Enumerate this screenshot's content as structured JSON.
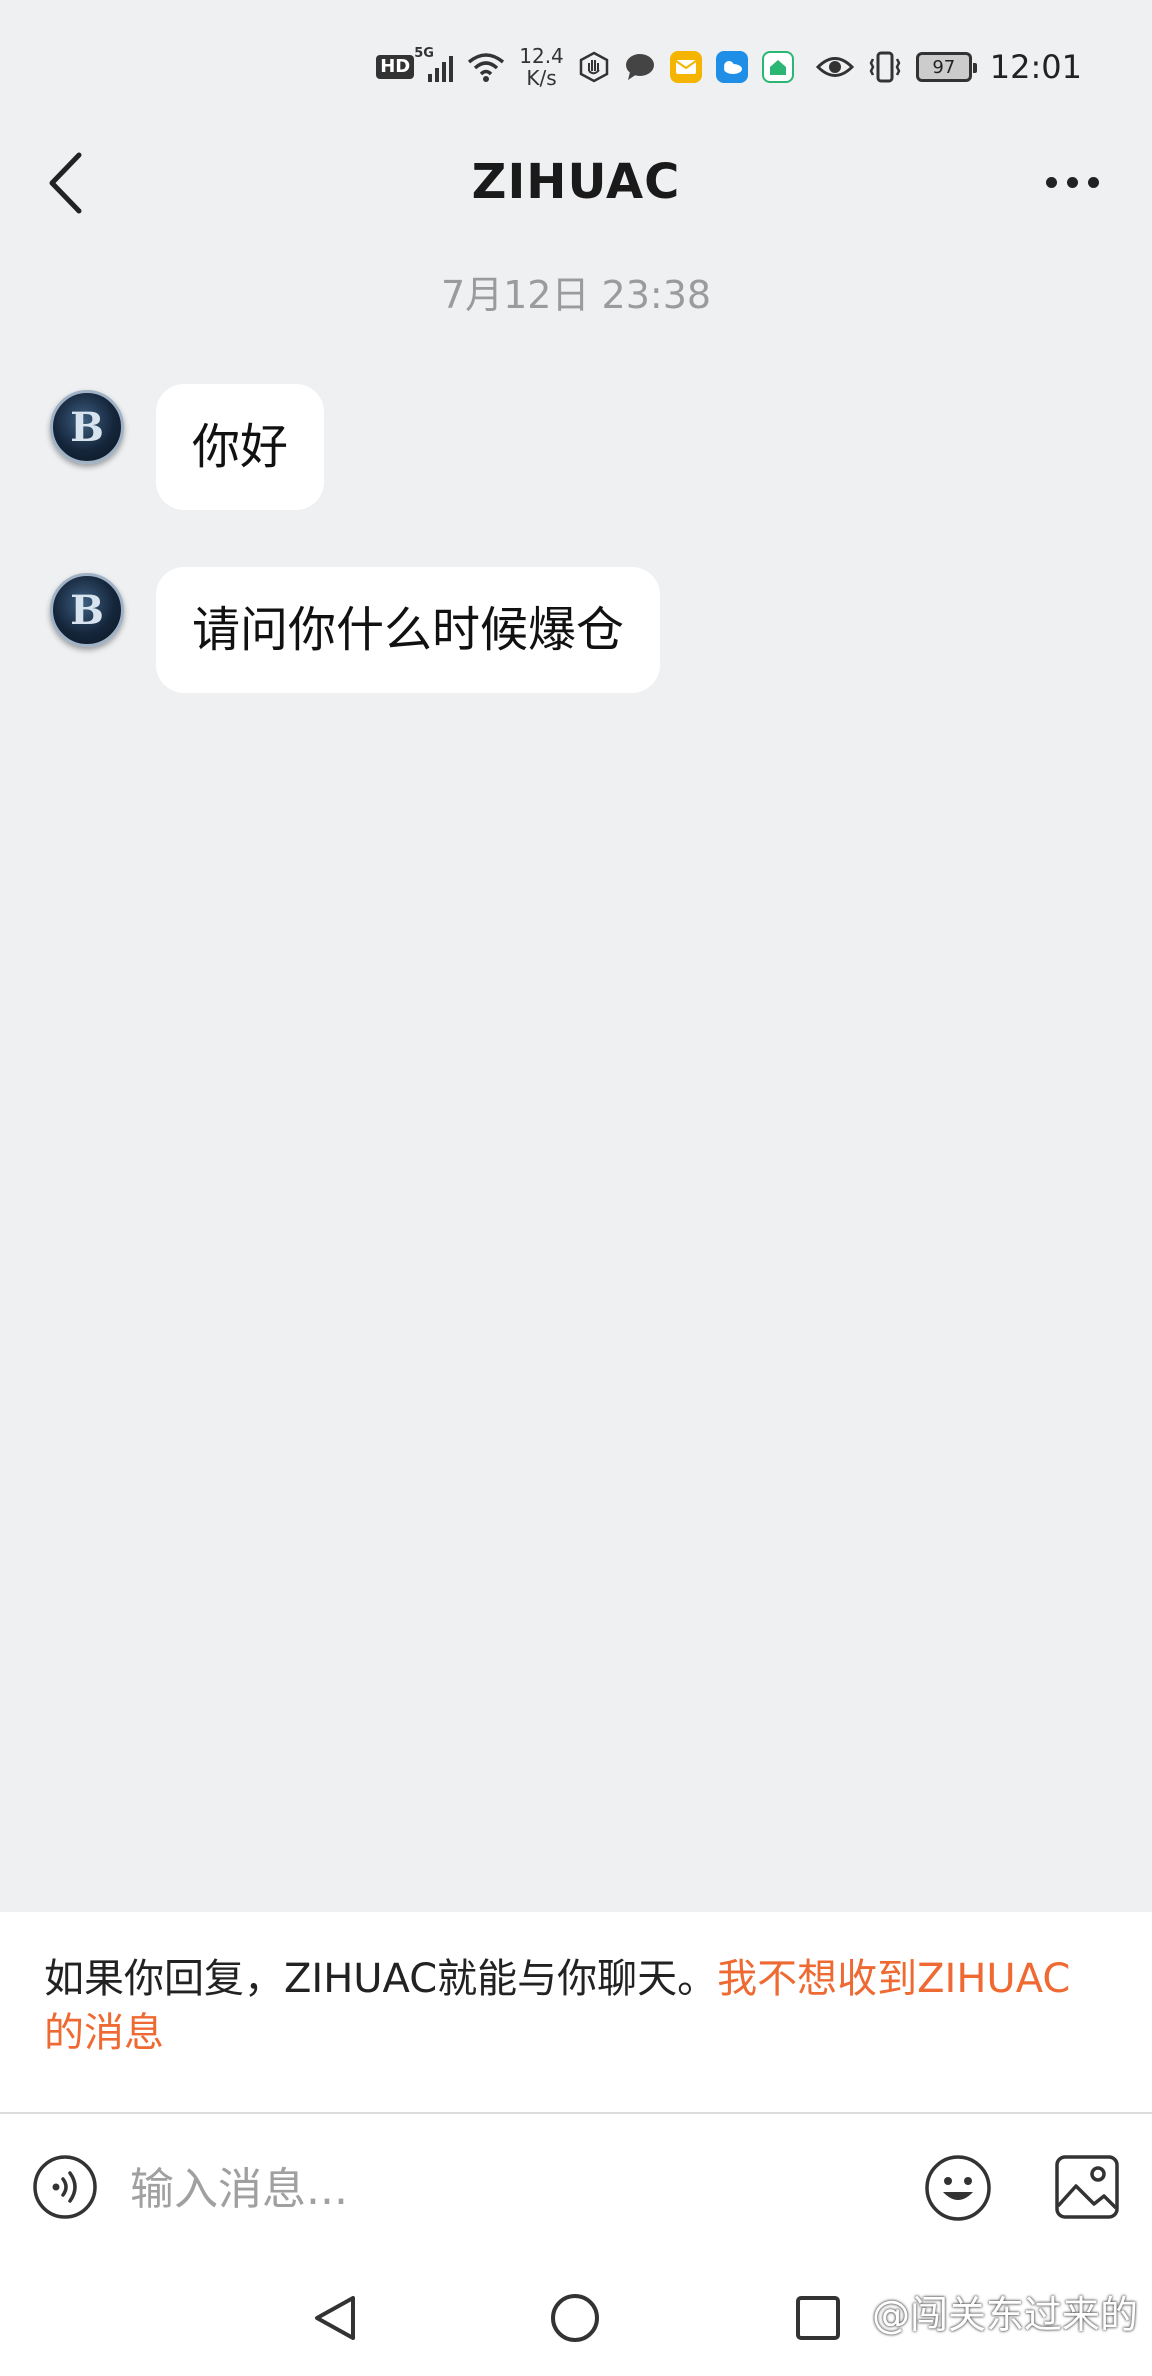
{
  "status_bar": {
    "hd_label": "HD",
    "network_label": "5G",
    "speed_value": "12.4",
    "speed_unit": "K/s",
    "battery_level": "97",
    "time": "12:01",
    "icons": [
      "hd-icon",
      "signal-icon",
      "wifi-icon",
      "hand-icon",
      "chat-icon",
      "mail-icon",
      "weather-icon",
      "home-app-icon",
      "eye-icon",
      "vibrate-icon",
      "battery-icon"
    ]
  },
  "header": {
    "title": "ZIHUAC"
  },
  "chat": {
    "timestamp": "7月12日 23:38",
    "messages": [
      {
        "text": "你好"
      },
      {
        "text": "请问你什么时候爆仓"
      }
    ],
    "avatar_glyph": "B"
  },
  "notice": {
    "text": "如果你回复，ZIHUAC就能与你聊天。",
    "link": "我不想收到ZIHUAC的消息"
  },
  "input_bar": {
    "placeholder": "输入消息..."
  },
  "watermark": "@闯关东过来的",
  "colors": {
    "background": "#eff0f2",
    "accent_link": "#ee6a32",
    "bubble": "#ffffff"
  }
}
